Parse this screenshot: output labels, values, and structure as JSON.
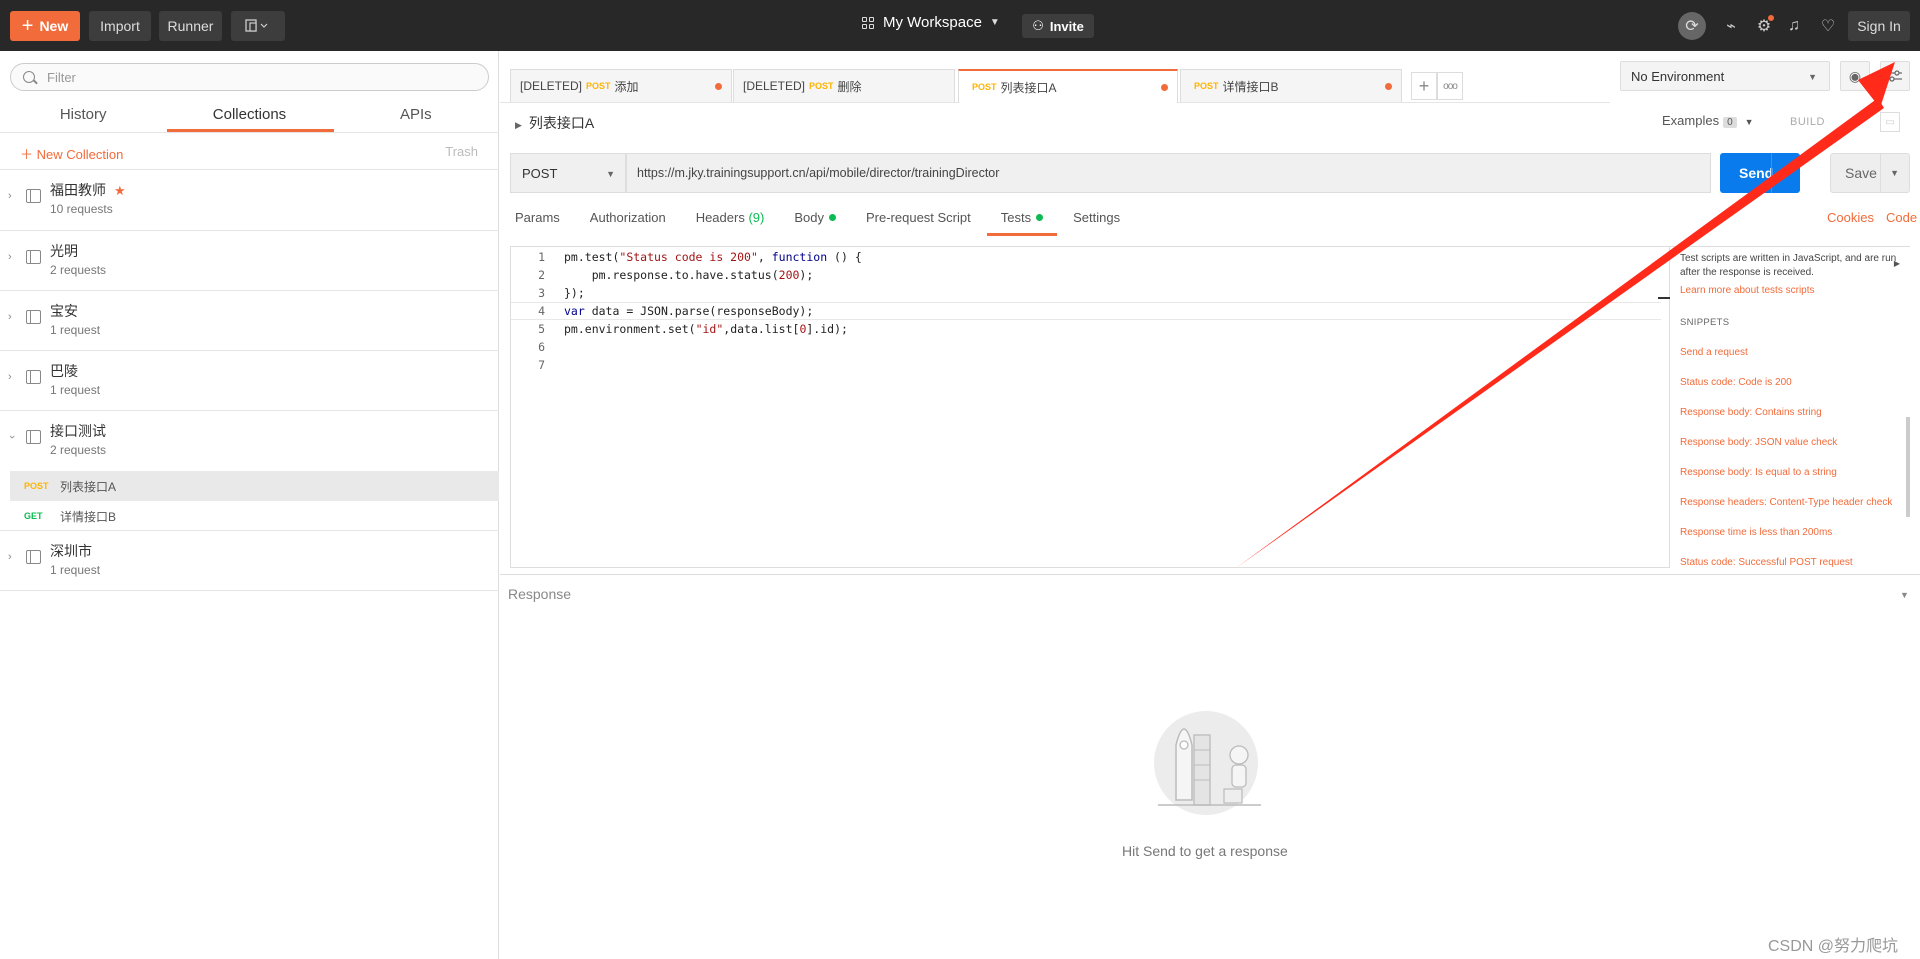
{
  "topbar": {
    "new_label": "New",
    "import_label": "Import",
    "runner_label": "Runner",
    "workspace_label": "My Workspace",
    "invite_label": "Invite",
    "signin_label": "Sign In"
  },
  "sidebar": {
    "filter_placeholder": "Filter",
    "tabs": [
      "History",
      "Collections",
      "APIs"
    ],
    "new_collection": "New Collection",
    "trash": "Trash",
    "collections": [
      {
        "name": "福田教师",
        "count": "10 requests",
        "starred": true
      },
      {
        "name": "光明",
        "count": "2 requests"
      },
      {
        "name": "宝安",
        "count": "1 request"
      },
      {
        "name": "巴陵",
        "count": "1 request"
      },
      {
        "name": "接口测试",
        "count": "2 requests",
        "expanded": true,
        "requests": [
          {
            "method": "POST",
            "name": "列表接口A",
            "selected": true
          },
          {
            "method": "GET",
            "name": "详情接口B"
          }
        ]
      },
      {
        "name": "深圳市",
        "count": "1 request"
      }
    ]
  },
  "tabs": [
    {
      "prefix": "[DELETED]",
      "method": "POST",
      "name": "添加"
    },
    {
      "prefix": "[DELETED]",
      "method": "POST",
      "name": "删除"
    },
    {
      "prefix": "",
      "method": "POST",
      "name": "列表接口A",
      "active": true
    },
    {
      "prefix": "",
      "method": "POST",
      "name": "详情接口B"
    }
  ],
  "environment": {
    "selected": "No Environment"
  },
  "request": {
    "name": "列表接口A",
    "examples_label": "Examples",
    "examples_count": "0",
    "build_label": "BUILD",
    "method": "POST",
    "url": "https://m.jky.trainingsupport.cn/api/mobile/director/trainingDirector",
    "send_label": "Send",
    "save_label": "Save",
    "subtabs": {
      "params": "Params",
      "authorization": "Authorization",
      "headers": "Headers",
      "headers_count": "(9)",
      "body": "Body",
      "prerequest": "Pre-request Script",
      "tests": "Tests",
      "settings": "Settings"
    },
    "cookies_label": "Cookies",
    "code_label": "Code"
  },
  "editor": {
    "line_numbers": [
      "1",
      "2",
      "3",
      "4",
      "5",
      "6",
      "7"
    ]
  },
  "snippets": {
    "description": "Test scripts are written in JavaScript, and are run after the response is received.",
    "learn_more": "Learn more about tests scripts",
    "header": "SNIPPETS",
    "items": [
      "Send a request",
      "Status code: Code is 200",
      "Response body: Contains string",
      "Response body: JSON value check",
      "Response body: Is equal to a string",
      "Response headers: Content-Type header check",
      "Response time is less than 200ms",
      "Status code: Successful POST request"
    ]
  },
  "response": {
    "label": "Response",
    "hint": "Hit Send to get a response"
  },
  "watermark": "CSDN @努力爬坑",
  "colors": {
    "accent": "#f26b3a",
    "send": "#097bed",
    "post": "#ffb400",
    "get": "#0cbb52",
    "annotation_arrow": "#ff2a1a"
  }
}
